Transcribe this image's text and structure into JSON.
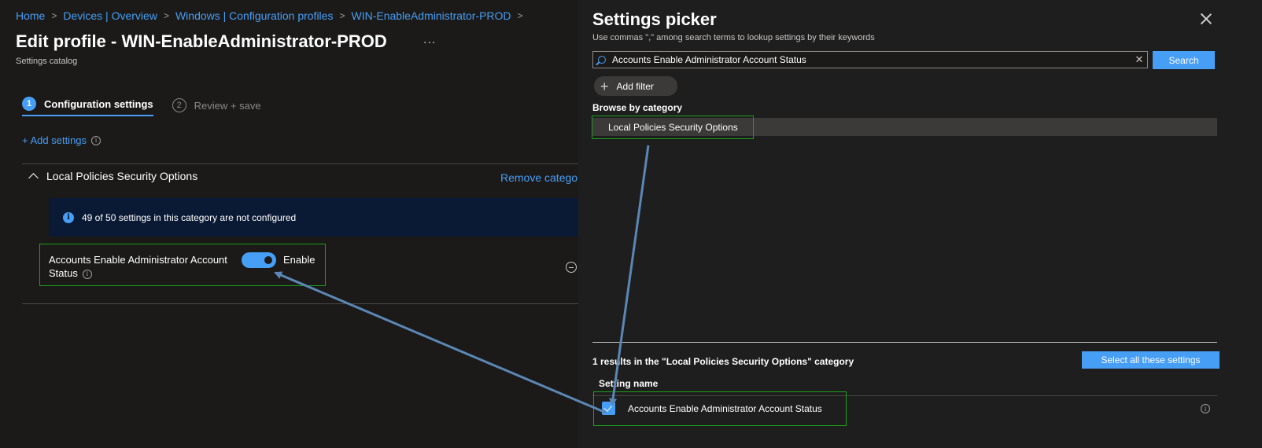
{
  "breadcrumb": [
    "Home",
    "Devices | Overview",
    "Windows | Configuration profiles",
    "WIN-EnableAdministrator-PROD"
  ],
  "page": {
    "title": "Edit profile - WIN-EnableAdministrator-PROD",
    "more": "...",
    "subtitle": "Settings catalog"
  },
  "steps": [
    {
      "num": "1",
      "label": "Configuration settings",
      "active": true
    },
    {
      "num": "2",
      "label": "Review + save",
      "active": false
    }
  ],
  "add_settings": "+ Add settings",
  "category": {
    "name": "Local Policies Security Options",
    "remove": "Remove category",
    "banner": "49 of 50 settings in this category are not configured",
    "setting": {
      "label": "Accounts Enable Administrator Account Status",
      "value_label": "Enable",
      "enabled": true
    }
  },
  "picker": {
    "title": "Settings picker",
    "subtitle": "Use commas \",\" among search terms to lookup settings by their keywords",
    "search_value": "Accounts Enable Administrator Account Status",
    "search_button": "Search",
    "add_filter": "Add filter",
    "browse_title": "Browse by category",
    "category_item": "Local Policies Security Options",
    "results_text": "1 results in the \"Local Policies Security Options\" category",
    "select_all": "Select all these settings",
    "column_header": "Setting name",
    "results": [
      {
        "label": "Accounts Enable Administrator Account Status",
        "checked": true
      }
    ]
  },
  "colors": {
    "accent": "#479ef5",
    "highlight_box": "#1aa11a",
    "annotation_arrow": "#5b87b5"
  }
}
